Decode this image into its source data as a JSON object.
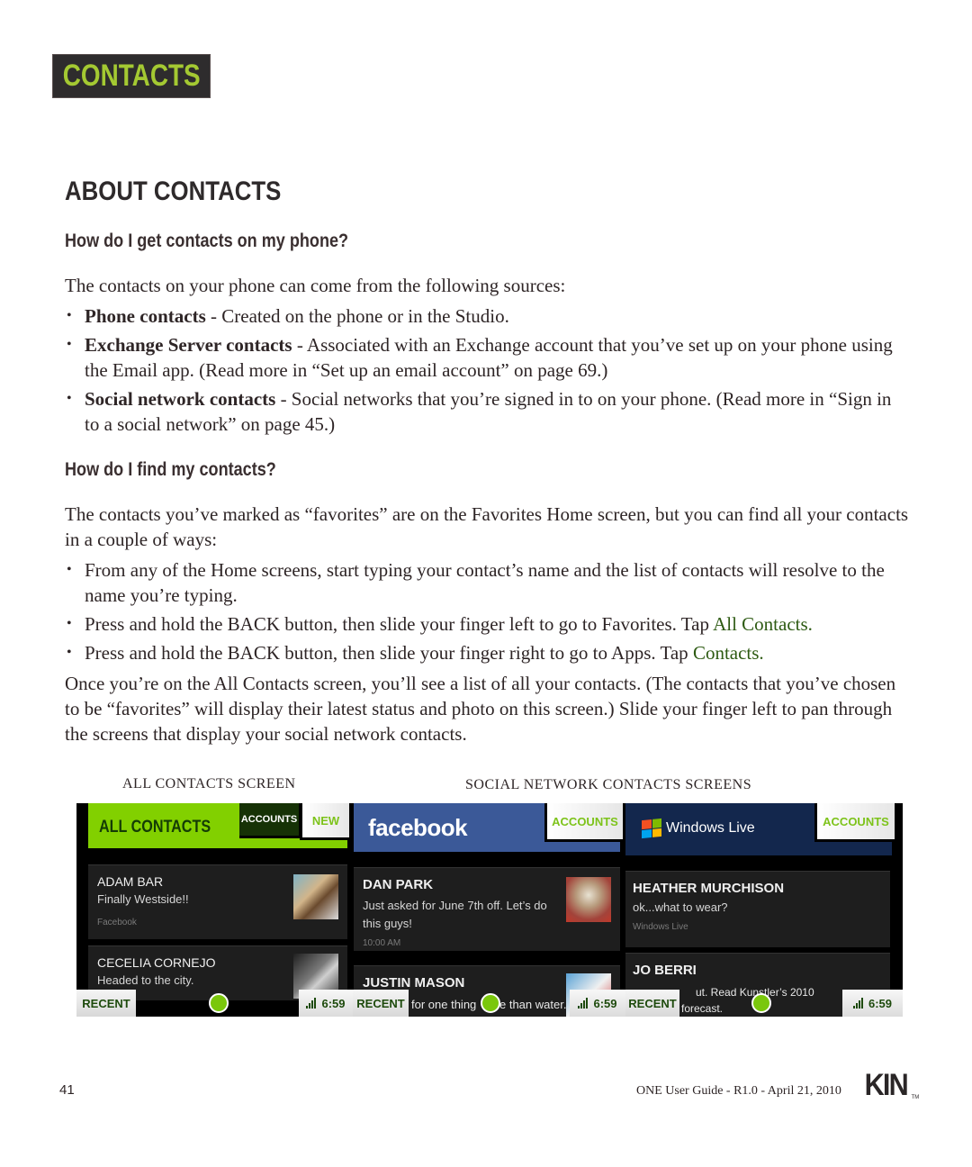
{
  "section_badge": "CONTACTS",
  "heading": "ABOUT CONTACTS",
  "q1": {
    "title": "How do I get contacts on my phone?",
    "intro": "The contacts on your phone can come from the following sources:",
    "bullets": [
      {
        "bold": "Phone contacts",
        "text": " - Created on the phone or in the Studio."
      },
      {
        "bold": "Exchange Server contacts",
        "text": " - Associated with an Exchange account that you’ve set up on your phone using the Email app. (Read more in “Set up an email account” on page 69.)"
      },
      {
        "bold": "Social network contacts",
        "text": " - Social networks that you’re signed in to on your phone. (Read more in “Sign in to a social network” on page 45.)"
      }
    ]
  },
  "q2": {
    "title": "How do I find my contacts?",
    "intro": "The contacts you’ve marked as “favorites” are on the Favorites Home screen, but you can find all your contacts in a couple of ways:",
    "bullets": [
      {
        "text": "From any of the Home screens, start typing your contact’s name and the list of contacts will resolve to the name you’re typing."
      },
      {
        "text": "Press and hold the BACK button, then slide your finger left to go to Favorites. Tap ",
        "link": "All Contacts."
      },
      {
        "text": "Press and hold the BACK button, then slide your finger right to go to Apps. Tap ",
        "link": "Contacts."
      }
    ],
    "outro": "Once you’re on the All Contacts screen, you’ll see a list of all your contacts. (The contacts that you’ve chosen to be “favorites” will display their latest status and photo on this screen.) Slide your finger left to pan through the screens that display your social network contacts."
  },
  "captions": {
    "all_contacts": "ALL CONTACTS SCREEN",
    "social": "SOCIAL NETWORK CONTACTS SCREENS"
  },
  "screens": {
    "all_contacts": {
      "title": "ALL CONTACTS",
      "accounts_tab": "ACCOUNTS",
      "new_tab": "NEW",
      "contacts": [
        {
          "name": "ADAM BAR",
          "status": "Finally Westside!!",
          "source": "Facebook"
        },
        {
          "name": "CECELIA CORNEJO",
          "status": "Headed to the city."
        }
      ]
    },
    "facebook": {
      "title": "facebook",
      "accounts_tab": "ACCOUNTS",
      "contacts": [
        {
          "name": "DAN PARK",
          "status": "Just asked for June 7th off. Let’s do this guys!",
          "time": "10:00 AM"
        },
        {
          "name": "JUSTIN MASON",
          "status": "for one thing",
          "status2": "e than water."
        }
      ]
    },
    "windows_live": {
      "title": "Windows Live",
      "accounts_tab": "ACCOUNTS",
      "contacts": [
        {
          "name": "HEATHER MURCHISON",
          "status": "ok...what to wear?",
          "source": "Windows Live"
        },
        {
          "name": "JO BERRI",
          "status": "ut. Read Kunstler’s 2010",
          "status2": "forecast."
        }
      ]
    },
    "bottom_bar": {
      "recent_label": "RECENT",
      "time": "6:59"
    },
    "colors": {
      "kin_green": "#82d000",
      "facebook_blue": "#3b5998",
      "windows_live_navy": "#13274d"
    }
  },
  "footer": {
    "page_number": "41",
    "guide": "ONE User Guide - R1.0 - April 21, 2010",
    "logo": "KIN",
    "tm": "TM"
  }
}
